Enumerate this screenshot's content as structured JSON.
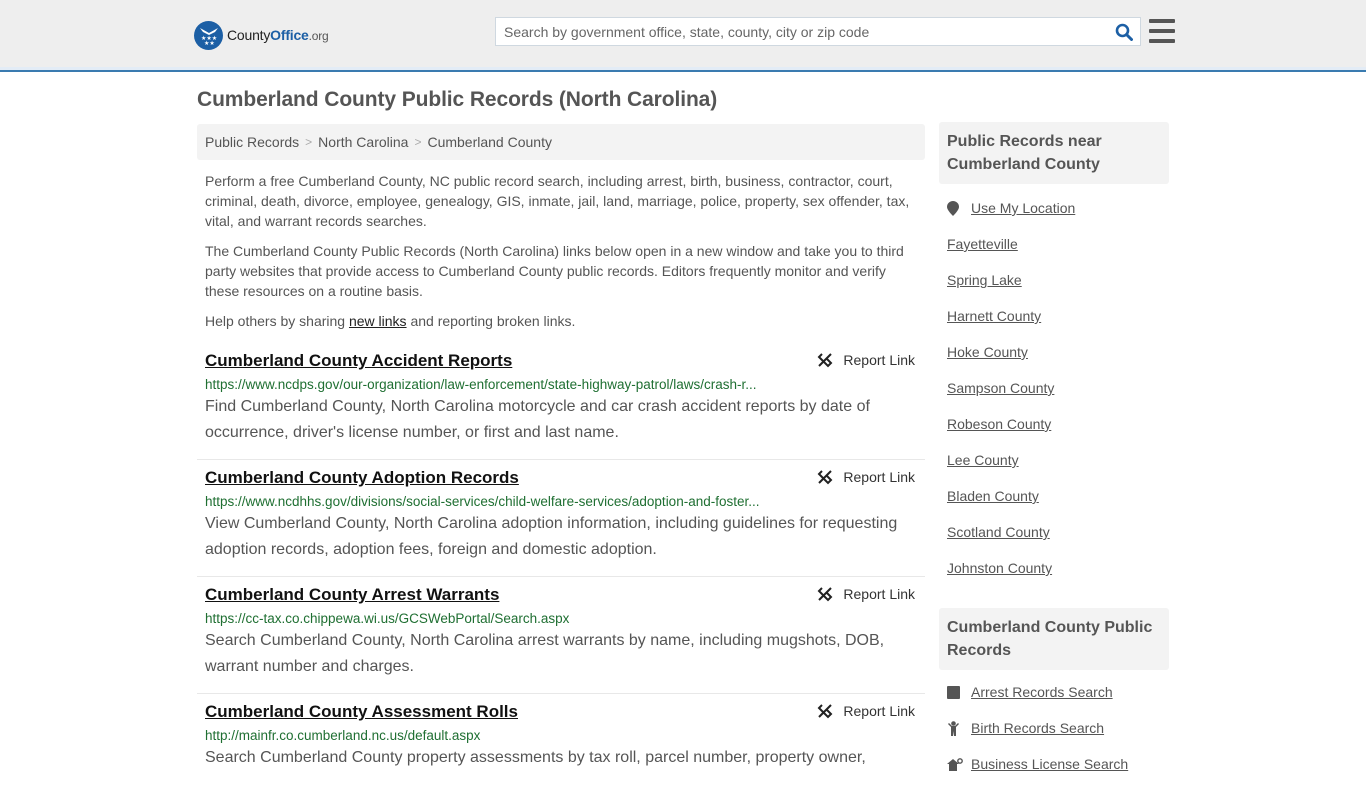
{
  "header": {
    "logo": {
      "county": "County",
      "office": "Office",
      "tld": ".org"
    },
    "search_placeholder": "Search by government office, state, county, city or zip code",
    "colors": {
      "brand": "#1c5fa5",
      "accent_border": "#3a7bb0"
    }
  },
  "page_title": "Cumberland County Public Records (North Carolina)",
  "breadcrumb": [
    {
      "label": "Public Records"
    },
    {
      "label": "North Carolina"
    },
    {
      "label": "Cumberland County"
    }
  ],
  "breadcrumb_separator": ">",
  "intro": {
    "p1": "Perform a free Cumberland County, NC public record search, including arrest, birth, business, contractor, court, criminal, death, divorce, employee, genealogy, GIS, inmate, jail, land, marriage, police, property, sex offender, tax, vital, and warrant records searches.",
    "p2": "The Cumberland County Public Records (North Carolina) links below open in a new window and take you to third party websites that provide access to Cumberland County public records. Editors frequently monitor and verify these resources on a routine basis.",
    "p3_before": "Help others by sharing ",
    "p3_link": "new links",
    "p3_after": " and reporting broken links."
  },
  "report_label": "Report Link",
  "records": [
    {
      "title": "Cumberland County Accident Reports",
      "url": "https://www.ncdps.gov/our-organization/law-enforcement/state-highway-patrol/laws/crash-r...",
      "desc": "Find Cumberland County, North Carolina motorcycle and car crash accident reports by date of occurrence, driver's license number, or first and last name."
    },
    {
      "title": "Cumberland County Adoption Records",
      "url": "https://www.ncdhhs.gov/divisions/social-services/child-welfare-services/adoption-and-foster...",
      "desc": "View Cumberland County, North Carolina adoption information, including guidelines for requesting adoption records, adoption fees, foreign and domestic adoption."
    },
    {
      "title": "Cumberland County Arrest Warrants",
      "url": "https://cc-tax.co.chippewa.wi.us/GCSWebPortal/Search.aspx",
      "desc": "Search Cumberland County, North Carolina arrest warrants by name, including mugshots, DOB, warrant number and charges."
    },
    {
      "title": "Cumberland County Assessment Rolls",
      "url": "http://mainfr.co.cumberland.nc.us/default.aspx",
      "desc": "Search Cumberland County property assessments by tax roll, parcel number, property owner,"
    }
  ],
  "sidebar": {
    "nearby": {
      "heading": "Public Records near Cumberland County",
      "use_location": "Use My Location",
      "items": [
        "Fayetteville",
        "Spring Lake",
        "Harnett County",
        "Hoke County",
        "Sampson County",
        "Robeson County",
        "Lee County",
        "Bladen County",
        "Scotland County",
        "Johnston County"
      ]
    },
    "categories": {
      "heading": "Cumberland County Public Records",
      "items": [
        {
          "label": "Arrest Records Search",
          "icon": "square-icon"
        },
        {
          "label": "Birth Records Search",
          "icon": "baby-icon"
        },
        {
          "label": "Business License Search",
          "icon": "business-icon"
        }
      ]
    }
  }
}
